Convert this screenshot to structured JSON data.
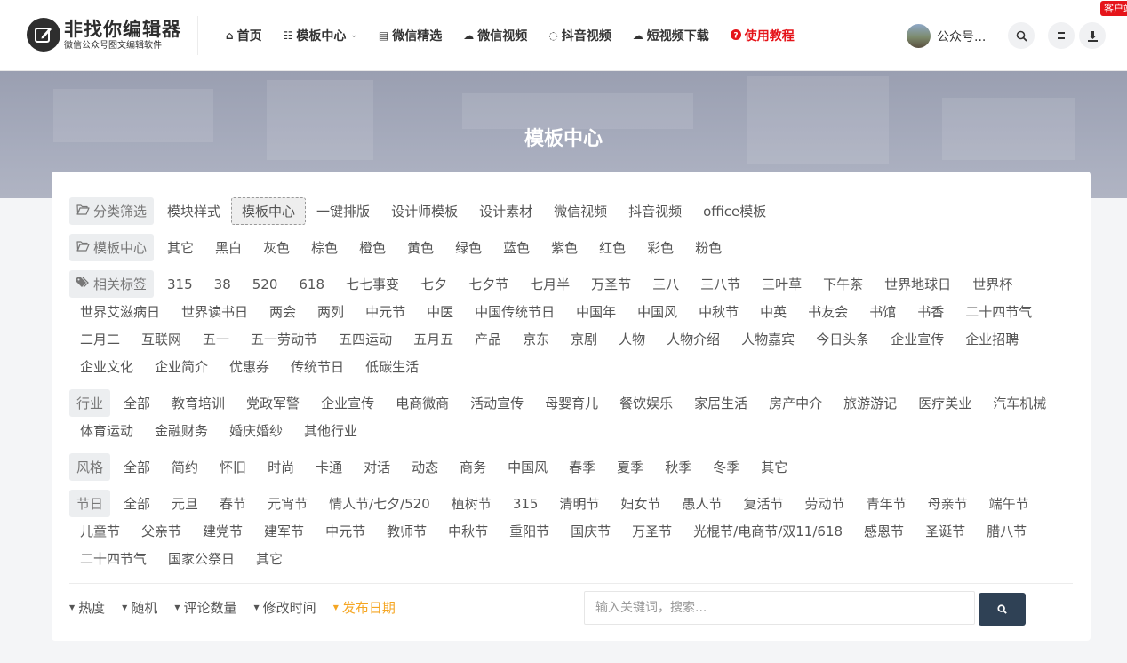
{
  "header": {
    "logo": {
      "title": "非找你编辑器",
      "subtitle": "微信公众号图文编辑软件"
    },
    "nav": [
      {
        "icon": "home-icon",
        "glyph": "⌂",
        "label": "首页"
      },
      {
        "icon": "sitemap-icon",
        "glyph": "☷",
        "label": "模板中心",
        "dropdown": true
      },
      {
        "icon": "newspaper-icon",
        "glyph": "▤",
        "label": "微信精选"
      },
      {
        "icon": "wechat-icon",
        "glyph": "☁",
        "label": "微信视频"
      },
      {
        "icon": "spinner-icon",
        "glyph": "◌",
        "label": "抖音视频"
      },
      {
        "icon": "cloud-download-icon",
        "glyph": "☁",
        "label": "短视频下载"
      },
      {
        "icon": "question-circle-icon",
        "glyph": "?",
        "label": "使用教程",
        "color": "#e5141a"
      }
    ],
    "user": {
      "name": "公众号..."
    },
    "kefu_label": "客户端"
  },
  "banner": {
    "title": "模板中心"
  },
  "filters": {
    "category": {
      "label": "分类筛选",
      "items": [
        "模块样式",
        "模板中心",
        "一键排版",
        "设计师模板",
        "设计素材",
        "微信视频",
        "抖音视频",
        "office模板"
      ],
      "active": "模板中心"
    },
    "template_colors": {
      "label": "模板中心",
      "items": [
        "其它",
        "黑白",
        "灰色",
        "棕色",
        "橙色",
        "黄色",
        "绿色",
        "蓝色",
        "紫色",
        "红色",
        "彩色",
        "粉色"
      ]
    },
    "tags": {
      "label": "相关标签",
      "items": [
        "315",
        "38",
        "520",
        "618",
        "七七事变",
        "七夕",
        "七夕节",
        "七月半",
        "万圣节",
        "三八",
        "三八节",
        "三叶草",
        "下午茶",
        "世界地球日",
        "世界杯",
        "世界艾滋病日",
        "世界读书日",
        "两会",
        "两列",
        "中元节",
        "中医",
        "中国传统节日",
        "中国年",
        "中国风",
        "中秋节",
        "中英",
        "书友会",
        "书馆",
        "书香",
        "二十四节气",
        "二月二",
        "互联网",
        "五一",
        "五一劳动节",
        "五四运动",
        "五月五",
        "产品",
        "京东",
        "京剧",
        "人物",
        "人物介绍",
        "人物嘉宾",
        "今日头条",
        "企业宣传",
        "企业招聘",
        "企业文化",
        "企业简介",
        "优惠券",
        "传统节日",
        "低碳生活"
      ]
    },
    "industry": {
      "label": "行业",
      "items": [
        "全部",
        "教育培训",
        "党政军警",
        "企业宣传",
        "电商微商",
        "活动宣传",
        "母婴育儿",
        "餐饮娱乐",
        "家居生活",
        "房产中介",
        "旅游游记",
        "医疗美业",
        "汽车机械",
        "体育运动",
        "金融财务",
        "婚庆婚纱",
        "其他行业"
      ]
    },
    "style": {
      "label": "风格",
      "items": [
        "全部",
        "简约",
        "怀旧",
        "时尚",
        "卡通",
        "对话",
        "动态",
        "商务",
        "中国风",
        "春季",
        "夏季",
        "秋季",
        "冬季",
        "其它"
      ]
    },
    "festival": {
      "label": "节日",
      "items": [
        "全部",
        "元旦",
        "春节",
        "元宵节",
        "情人节/七夕/520",
        "植树节",
        "315",
        "清明节",
        "妇女节",
        "愚人节",
        "复活节",
        "劳动节",
        "青年节",
        "母亲节",
        "端午节",
        "儿童节",
        "父亲节",
        "建党节",
        "建军节",
        "中元节",
        "教师节",
        "中秋节",
        "重阳节",
        "国庆节",
        "万圣节",
        "光棍节/电商节/双11/618",
        "感恩节",
        "圣诞节",
        "腊八节",
        "二十四节气",
        "国家公祭日",
        "其它"
      ]
    }
  },
  "sort": {
    "items": [
      "热度",
      "随机",
      "评论数量",
      "修改时间",
      "发布日期"
    ],
    "active": "发布日期"
  },
  "search": {
    "placeholder": "输入关键词，搜索..."
  },
  "colors": {
    "accent_orange": "#f5a623",
    "nav_red": "#e5141a",
    "search_button": "#2f4155"
  }
}
